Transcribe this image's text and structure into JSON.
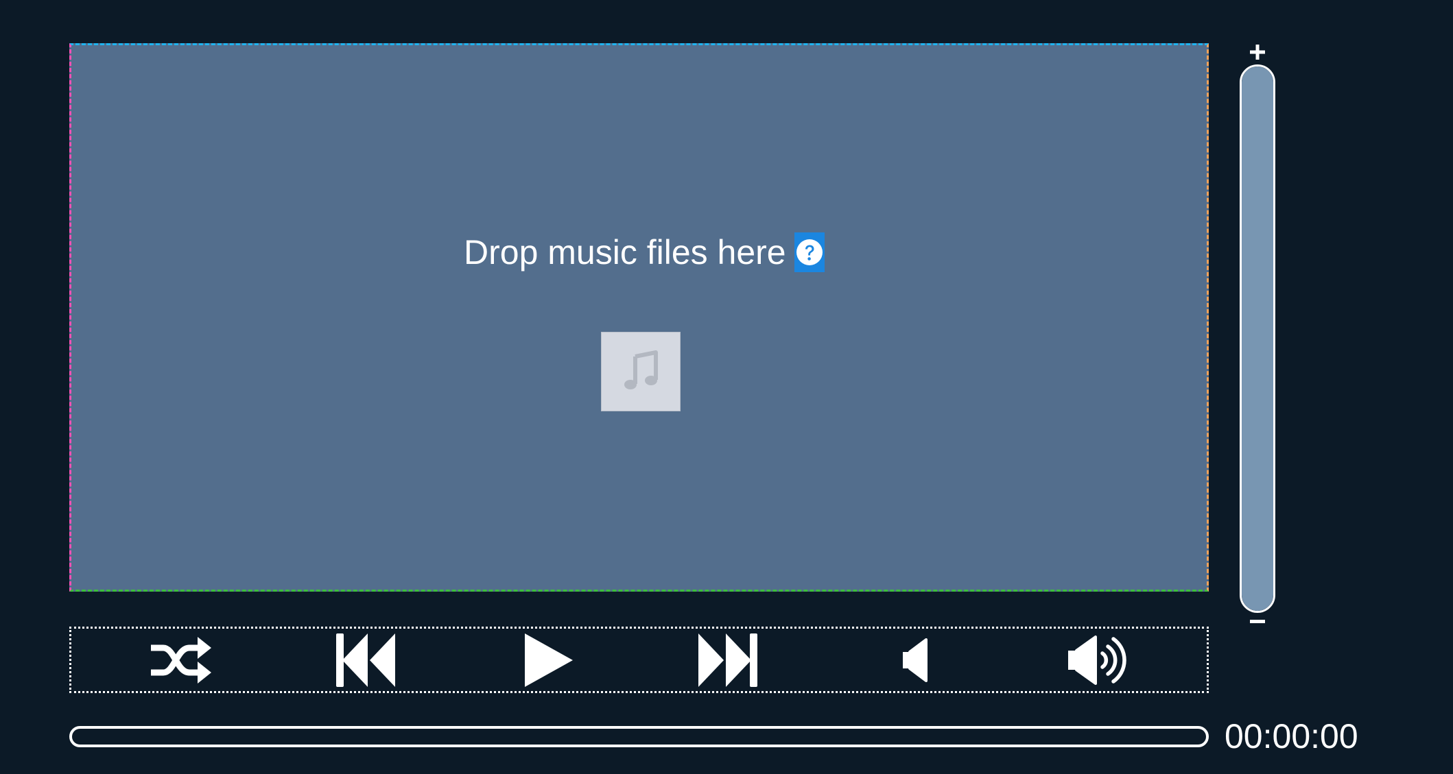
{
  "dropzone": {
    "prompt": "Drop music files here",
    "help_icon": "question-circle-icon",
    "album_placeholder_icon": "music-note-icon"
  },
  "volume": {
    "increase_icon": "plus-icon",
    "decrease_icon": "minus-icon",
    "level": 1.0
  },
  "controls": {
    "buttons": [
      {
        "name": "shuffle-button",
        "icon": "shuffle-icon"
      },
      {
        "name": "previous-button",
        "icon": "skip-previous-icon"
      },
      {
        "name": "play-button",
        "icon": "play-icon"
      },
      {
        "name": "next-button",
        "icon": "skip-next-icon"
      },
      {
        "name": "volume-down-button",
        "icon": "volume-low-icon"
      },
      {
        "name": "volume-up-button",
        "icon": "volume-high-icon"
      }
    ]
  },
  "progress": {
    "value": 0,
    "time": "00:00:00"
  },
  "colors": {
    "background": "#0c1a27",
    "dropzone": "#536e8d",
    "accent_help": "#1b86e0",
    "volume_fill": "#7896b2",
    "border_top": "#1fb4f0",
    "border_right": "#f3a35b",
    "border_bottom": "#3cbf3c",
    "border_left": "#ff4fb4"
  }
}
